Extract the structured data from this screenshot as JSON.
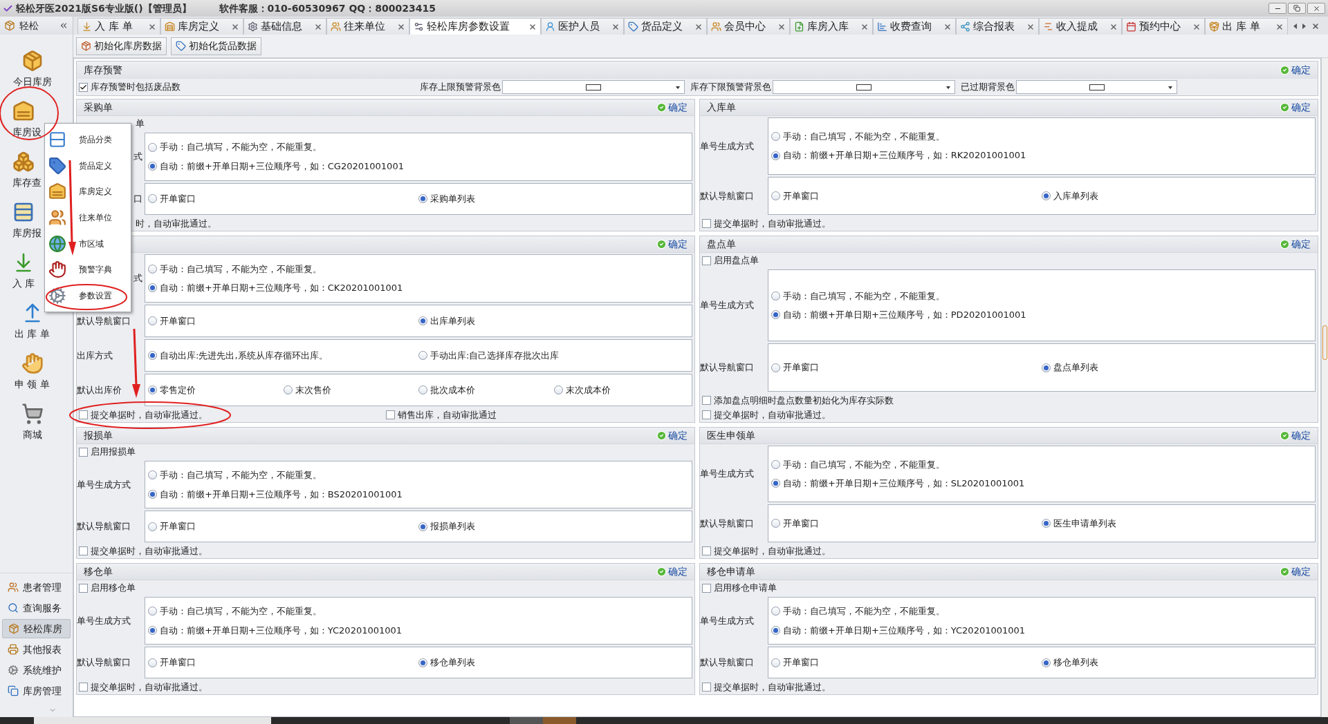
{
  "window": {
    "title": "轻松牙医2021版S6专业版()【管理员】",
    "support": "软件客服：010-60530967 QQ：800023415"
  },
  "sidebar": {
    "title": "轻松",
    "items": [
      {
        "label": "今日库房",
        "clipped": false
      },
      {
        "label": "库房设",
        "clipped": true
      },
      {
        "label": "库存查",
        "clipped": true
      },
      {
        "label": "库房报",
        "clipped": true
      },
      {
        "label": "入 库",
        "clipped": true
      },
      {
        "label": "出 库 单",
        "clipped": false
      },
      {
        "label": "申 领 单",
        "clipped": false
      },
      {
        "label": "商城",
        "clipped": false
      }
    ],
    "nav": [
      {
        "label": "患者管理",
        "selected": false
      },
      {
        "label": "查询服务",
        "selected": false
      },
      {
        "label": "轻松库房",
        "selected": true
      },
      {
        "label": "其他报表",
        "selected": false
      },
      {
        "label": "系统维护",
        "selected": false
      },
      {
        "label": "库房管理",
        "selected": false
      }
    ]
  },
  "tabs": [
    {
      "label": "入 库 单",
      "selected": false
    },
    {
      "label": "库房定义",
      "selected": false
    },
    {
      "label": "基础信息",
      "selected": false
    },
    {
      "label": "往来单位",
      "selected": false
    },
    {
      "label": "轻松库房参数设置",
      "selected": true
    },
    {
      "label": "医护人员",
      "selected": false
    },
    {
      "label": "货品定义",
      "selected": false
    },
    {
      "label": "会员中心",
      "selected": false
    },
    {
      "label": "库房入库",
      "selected": false
    },
    {
      "label": "收费查询",
      "selected": false
    },
    {
      "label": "综合报表",
      "selected": false
    },
    {
      "label": "收入提成",
      "selected": false
    },
    {
      "label": "预约中心",
      "selected": false
    },
    {
      "label": "出 库 单",
      "selected": false
    }
  ],
  "toolbar": [
    "初始化库房数据",
    "初始化货品数据"
  ],
  "popup_menu": [
    "货品分类",
    "货品定义",
    "库房定义",
    "往来单位",
    "市区域",
    "预警字典",
    "参数设置"
  ],
  "stock_alert": {
    "title": "库存预警",
    "confirm": "确定",
    "include_scrap": {
      "label": "库存预警时包括废品数",
      "checked": true
    },
    "colors": [
      {
        "label": "库存上限预警背景色",
        "color": "#ffffff"
      },
      {
        "label": "库存下限预警背景色",
        "color": "#ffffff"
      },
      {
        "label": "已过期背景色",
        "color": "#ffffff"
      }
    ]
  },
  "panels": [
    {
      "title": "采购单",
      "confirm": "确定",
      "enable": {
        "label": "单",
        "clipped": true
      },
      "fields": [
        {
          "label": "式",
          "clipped": true,
          "kind": "stack",
          "options": [
            {
              "label": "手动：自己填写，不能为空，不能重复。",
              "selected": false
            },
            {
              "label": "自动：前缀+开单日期+三位顺序号，如：CG20201001001",
              "selected": true
            }
          ]
        },
        {
          "label": "口",
          "clipped": true,
          "kind": "row",
          "options": [
            {
              "label": "开单窗口",
              "selected": false
            },
            {
              "label": "采购单列表",
              "selected": true
            }
          ]
        }
      ],
      "checks": [
        [
          {
            "label": "时，自动审批通过。",
            "clipped": true
          }
        ]
      ]
    },
    {
      "title": "入库单",
      "confirm": "确定",
      "fields": [
        {
          "label": "单号生成方式",
          "kind": "stack",
          "options": [
            {
              "label": "手动：自己填写，不能为空，不能重复。",
              "selected": false
            },
            {
              "label": "自动：前缀+开单日期+三位顺序号，如：RK20201001001",
              "selected": true
            }
          ]
        },
        {
          "label": "默认导航窗口",
          "kind": "row",
          "options": [
            {
              "label": "开单窗口",
              "selected": false
            },
            {
              "label": "入库单列表",
              "selected": true
            }
          ]
        }
      ],
      "checks": [
        [
          {
            "label": "提交单据时，自动审批通过。",
            "checked": false
          }
        ]
      ]
    },
    {
      "confirm": "确定",
      "fields": [
        {
          "label": "式",
          "clipped": true,
          "kind": "stack",
          "options": [
            {
              "label": "手动：自己填写，不能为空，不能重复。",
              "selected": false
            },
            {
              "label": "自动：前缀+开单日期+三位顺序号，如：CK20201001001",
              "selected": true
            }
          ]
        },
        {
          "label": "默认导航窗口",
          "kind": "row",
          "options": [
            {
              "label": "开单窗口",
              "selected": false
            },
            {
              "label": "出库单列表",
              "selected": true
            }
          ]
        },
        {
          "label": "出库方式",
          "kind": "row",
          "options": [
            {
              "label": "自动出库:先进先出,系统从库存循环出库。",
              "selected": true
            },
            {
              "label": "手动出库:自己选择库存批次出库",
              "selected": false
            }
          ]
        },
        {
          "label": "默认出库价",
          "kind": "row",
          "options": [
            {
              "label": "零售定价",
              "selected": true
            },
            {
              "label": "末次售价",
              "selected": false
            },
            {
              "label": "批次成本价",
              "selected": false
            },
            {
              "label": "末次成本价",
              "selected": false
            }
          ]
        }
      ],
      "checks": [
        [
          {
            "label": "提交单据时，自动审批通过。",
            "checked": false
          },
          {
            "label": "销售出库，自动审批通过",
            "checked": false
          }
        ]
      ]
    },
    {
      "title": "盘点单",
      "confirm": "确定",
      "enable": {
        "label": "启用盘点单",
        "checked": false
      },
      "fields": [
        {
          "label": "单号生成方式",
          "kind": "stack",
          "options": [
            {
              "label": "手动：自己填写，不能为空，不能重复。",
              "selected": false
            },
            {
              "label": "自动：前缀+开单日期+三位顺序号，如：PD20201001001",
              "selected": true
            }
          ]
        },
        {
          "label": "默认导航窗口",
          "kind": "row",
          "options": [
            {
              "label": "开单窗口",
              "selected": false
            },
            {
              "label": "盘点单列表",
              "selected": true
            }
          ]
        }
      ],
      "checks": [
        [
          {
            "label": "添加盘点明细时盘点数量初始化为库存实际数",
            "checked": false
          }
        ],
        [
          {
            "label": "提交单据时，自动审批通过。",
            "checked": false
          }
        ]
      ]
    },
    {
      "title": "报损单",
      "confirm": "确定",
      "enable": {
        "label": "启用报损单",
        "checked": false
      },
      "fields": [
        {
          "label": "单号生成方式",
          "kind": "stack",
          "options": [
            {
              "label": "手动：自己填写，不能为空，不能重复。",
              "selected": false
            },
            {
              "label": "自动：前缀+开单日期+三位顺序号，如：BS20201001001",
              "selected": true
            }
          ]
        },
        {
          "label": "默认导航窗口",
          "kind": "row",
          "options": [
            {
              "label": "开单窗口",
              "selected": false
            },
            {
              "label": "报损单列表",
              "selected": true
            }
          ]
        }
      ],
      "checks": [
        [
          {
            "label": "提交单据时，自动审批通过。",
            "checked": false
          }
        ]
      ]
    },
    {
      "title": "医生申领单",
      "confirm": "确定",
      "fields": [
        {
          "label": "单号生成方式",
          "kind": "stack",
          "options": [
            {
              "label": "手动：自己填写，不能为空，不能重复。",
              "selected": false
            },
            {
              "label": "自动：前缀+开单日期+三位顺序号，如：SL20201001001",
              "selected": true
            }
          ]
        },
        {
          "label": "默认导航窗口",
          "kind": "row",
          "options": [
            {
              "label": "开单窗口",
              "selected": false
            },
            {
              "label": "医生申请单列表",
              "selected": true
            }
          ]
        }
      ],
      "checks": [
        [
          {
            "label": "提交单据时，自动审批通过。",
            "checked": false
          }
        ]
      ]
    },
    {
      "title": "移仓单",
      "confirm": "确定",
      "enable": {
        "label": "启用移仓单",
        "checked": false
      },
      "fields": [
        {
          "label": "单号生成方式",
          "kind": "stack",
          "options": [
            {
              "label": "手动：自己填写，不能为空，不能重复。",
              "selected": false
            },
            {
              "label": "自动：前缀+开单日期+三位顺序号，如：YC20201001001",
              "selected": true
            }
          ]
        },
        {
          "label": "默认导航窗口",
          "kind": "row",
          "options": [
            {
              "label": "开单窗口",
              "selected": false
            },
            {
              "label": "移仓单列表",
              "selected": true
            }
          ]
        }
      ],
      "checks": [
        [
          {
            "label": "提交单据时，自动审批通过。",
            "checked": false
          }
        ]
      ]
    },
    {
      "title": "移仓申请单",
      "confirm": "确定",
      "enable": {
        "label": "启用移仓申请单",
        "checked": false
      },
      "fields": [
        {
          "label": "单号生成方式",
          "kind": "stack",
          "options": [
            {
              "label": "手动：自己填写，不能为空，不能重复。",
              "selected": false
            },
            {
              "label": "自动：前缀+开单日期+三位顺序号，如：YC20201001001",
              "selected": true
            }
          ]
        },
        {
          "label": "默认导航窗口",
          "kind": "row",
          "options": [
            {
              "label": "开单窗口",
              "selected": false
            },
            {
              "label": "移仓单列表",
              "selected": true
            }
          ]
        }
      ],
      "checks": [
        [
          {
            "label": "提交单据时，自动审批通过。",
            "checked": false
          }
        ]
      ]
    }
  ]
}
